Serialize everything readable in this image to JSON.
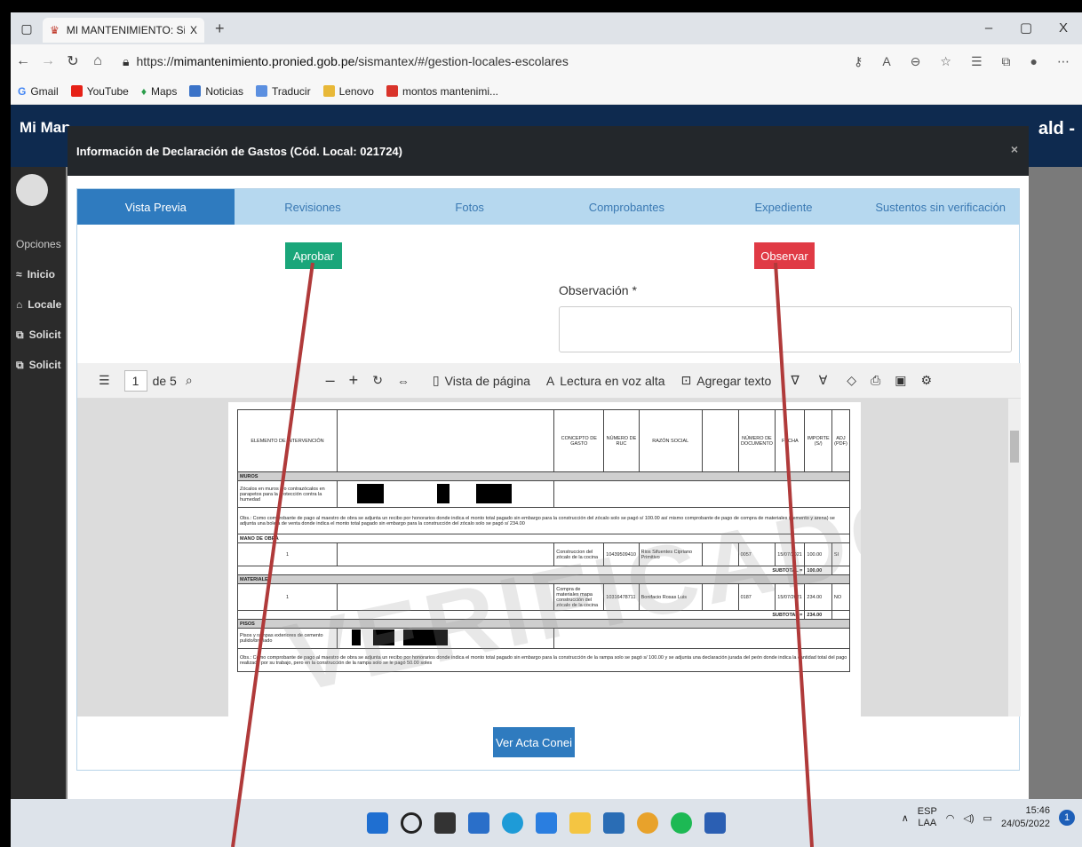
{
  "browser": {
    "tab_title": "MI MANTENIMIENTO: Sistema d",
    "tab_close": "X",
    "new_tab": "+",
    "url_prefix": "https://",
    "url_host": "mimantenimiento.pronied.gob.pe",
    "url_path": "/sismantex/#/gestion-locales-escolares",
    "bookmarks": [
      "Gmail",
      "YouTube",
      "Maps",
      "Noticias",
      "Traducir",
      "Lenovo",
      "montos mantenimi..."
    ]
  },
  "app": {
    "name": "Mi Man",
    "user_fragment": "ald -",
    "sidebar": [
      "Opciones",
      "Inicio",
      "Locale",
      "Solicit",
      "Solicit"
    ]
  },
  "modal": {
    "title": "Información de Declaración de Gastos (Cód. Local: 021724)",
    "close": "×",
    "tabs": [
      "Vista Previa",
      "Revisiones",
      "Fotos",
      "Comprobantes",
      "Expediente",
      "Sustentos sin verificación"
    ],
    "approve_label": "Aprobar",
    "observe_label": "Observar",
    "observation_label": "Observación *",
    "view_act_label": "Ver Acta Conei"
  },
  "pdf": {
    "page": "1",
    "of_pages": "de 5",
    "page_view": "Vista de página",
    "read_aloud": "Lectura en voz alta",
    "add_text": "Agregar texto",
    "col_element": "ELEMENTO DE INTERVENCIÓN",
    "col_concept": "CONCEPTO DE GASTO",
    "col_ruc": "NÚMERO DE RUC",
    "col_razon": "RAZÓN SOCIAL",
    "col_numdoc": "NÚMERO DE DOCUMENTO",
    "col_fecha": "FECHA",
    "col_importe": "IMPORTE (S/)",
    "col_adj": "ADJ (PDF)",
    "sec_muros": "MUROS",
    "row_zocalos": "Zócalos en muros y/o contrazócalos en parapetos para la protección contra la humedad",
    "obs_1": "Obs.: Como comprobante de pago al maestro de obra se adjunta un recibo por honorarios donde indica el monto total pagado sin embargo para la construcción del zócalo solo se pagó s/ 100.00 así mismo comprobante de pago de compra de materiales (cemento y arena) se adjunta una boleta de venta donde indica el monto total pagado sin embargo para la construcción del zócalo solo se pagó s/ 234.00",
    "sub_mano": "MANO DE OBRA",
    "mo_item": "1",
    "mo_concept": "Construccion del zócalo de la cocina",
    "mo_ruc": "10439509410",
    "mo_razon": "Rios Sifuentes Cipriano Primitivo",
    "mo_doc": "0057",
    "mo_fecha": "15/07/2021",
    "mo_importe": "100.00",
    "mo_adj": "SI",
    "subtotal_label": "SUBTOTAL =",
    "mo_subtotal": "100.00",
    "sub_mat": "MATERIALES",
    "mat_item": "1",
    "mat_concept": "Compra de materiales mapa construcción del zócalo de la cocina",
    "mat_ruc": "10316478711",
    "mat_razon": "Bonifacio Rosas Luis",
    "mat_doc": "0187",
    "mat_fecha": "15/07/2021",
    "mat_importe": "234.00",
    "mat_adj": "NO",
    "mat_subtotal": "234.00",
    "sec_pisos": "PISOS",
    "row_pisos": "Pisos y rampas exteriores de cemento pulido/bruñado",
    "obs_2": "Obs.: Como comprobante de pago al maestro de obra se adjunta un recibo por honorarios donde indica el monto total pagado sin embargo para la construcción de la rampa solo se pagó s/ 100.00 y se adjunta una declaración jurada del peón donde indica la cantidad total del pago realizado por su trabajo, pero en la construcción de la rampa solo se le pagó 50.00 soles",
    "watermark": "VERIFICADO"
  },
  "taskbar": {
    "lang": "ESP",
    "lang2": "LAA",
    "time": "15:46",
    "date": "24/05/2022",
    "badge": "1"
  },
  "colors": {
    "approve": "#1aa67a",
    "observe": "#e03a45",
    "tab_active": "#2f7bbf",
    "annotation_line": "#b03a3a"
  }
}
